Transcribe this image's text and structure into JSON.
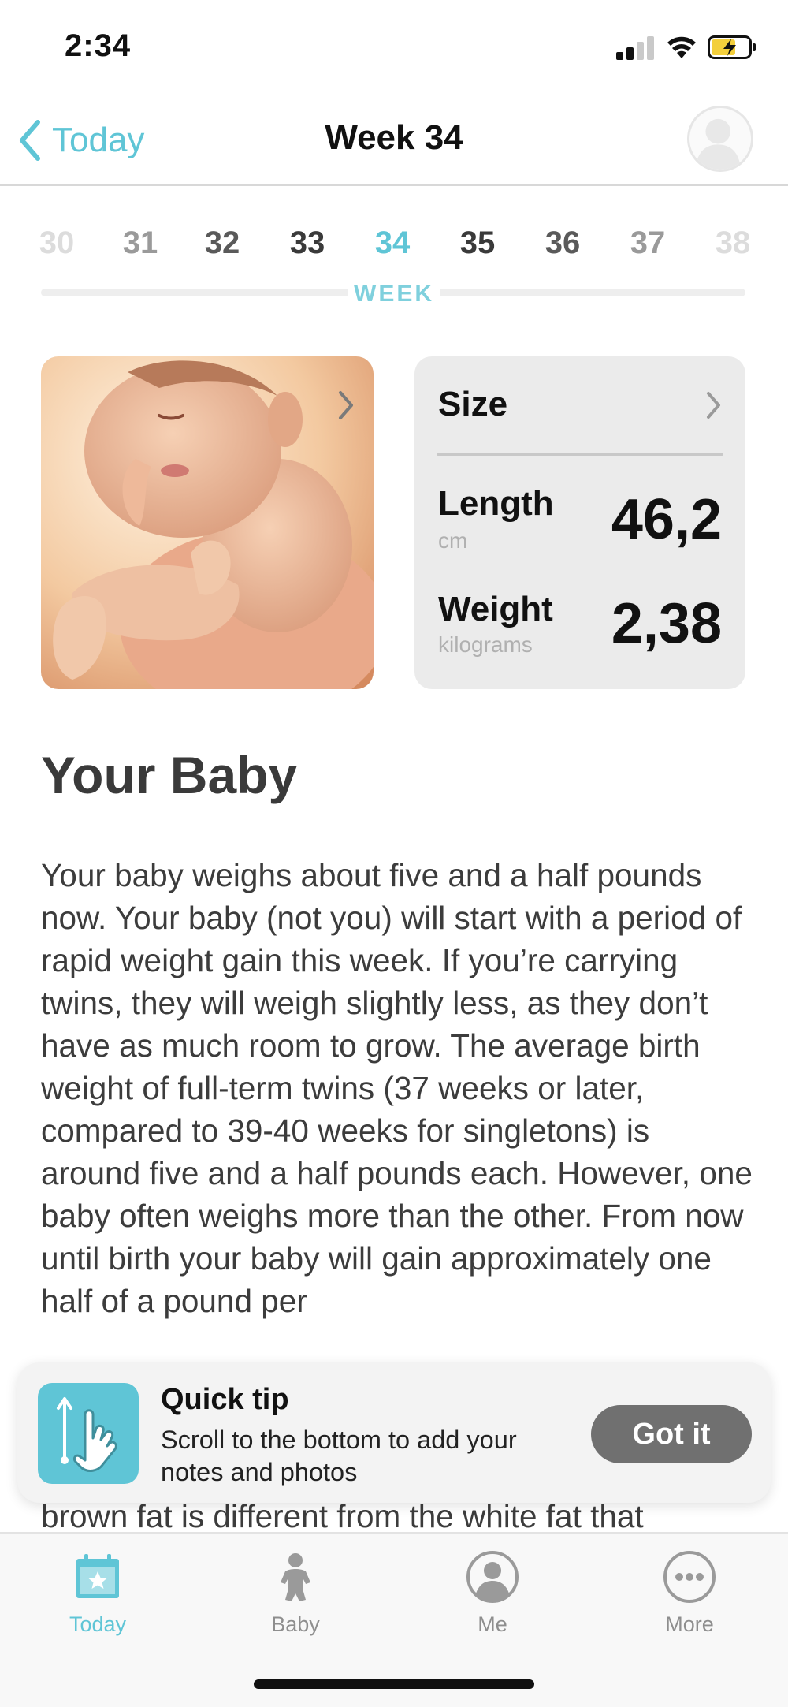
{
  "status_bar": {
    "time": "2:34"
  },
  "nav": {
    "back_label": "Today",
    "title": "Week 34"
  },
  "weeks": {
    "items": [
      "30",
      "31",
      "32",
      "33",
      "34",
      "35",
      "36",
      "37",
      "38"
    ],
    "selected": "34",
    "label": "WEEK"
  },
  "size_card": {
    "title": "Size",
    "length_label": "Length",
    "length_unit": "cm",
    "length_value": "46,2",
    "weight_label": "Weight",
    "weight_unit": "kilograms",
    "weight_value": "2,38"
  },
  "article": {
    "title": "Your Baby",
    "body": "Your baby weighs about five and a half pounds now. Your baby (not you) will start with a period of rapid weight gain this week. If you’re carrying twins, they will weigh slightly less, as they don’t have as much room to grow. The average birth weight of full-term twins (37 weeks or later, compared to 39-40 weeks for singletons) is around five and a half pounds each. However, one baby often weighs more than the other. From now until birth your baby will gain approximately one half of a pound per",
    "tail": "brown fat is different from the white fat that"
  },
  "quick_tip": {
    "title": "Quick tip",
    "text": "Scroll to the bottom to add your notes and photos",
    "button": "Got it"
  },
  "tabs": [
    {
      "label": "Today",
      "icon": "calendar-star-icon",
      "active": true
    },
    {
      "label": "Baby",
      "icon": "baby-icon",
      "active": false
    },
    {
      "label": "Me",
      "icon": "person-icon",
      "active": false
    },
    {
      "label": "More",
      "icon": "more-dots-icon",
      "active": false
    }
  ],
  "colors": {
    "accent": "#5fc5d6",
    "card_bg": "#ebebeb",
    "tip_button": "#707070",
    "text": "#3c3c3c"
  }
}
